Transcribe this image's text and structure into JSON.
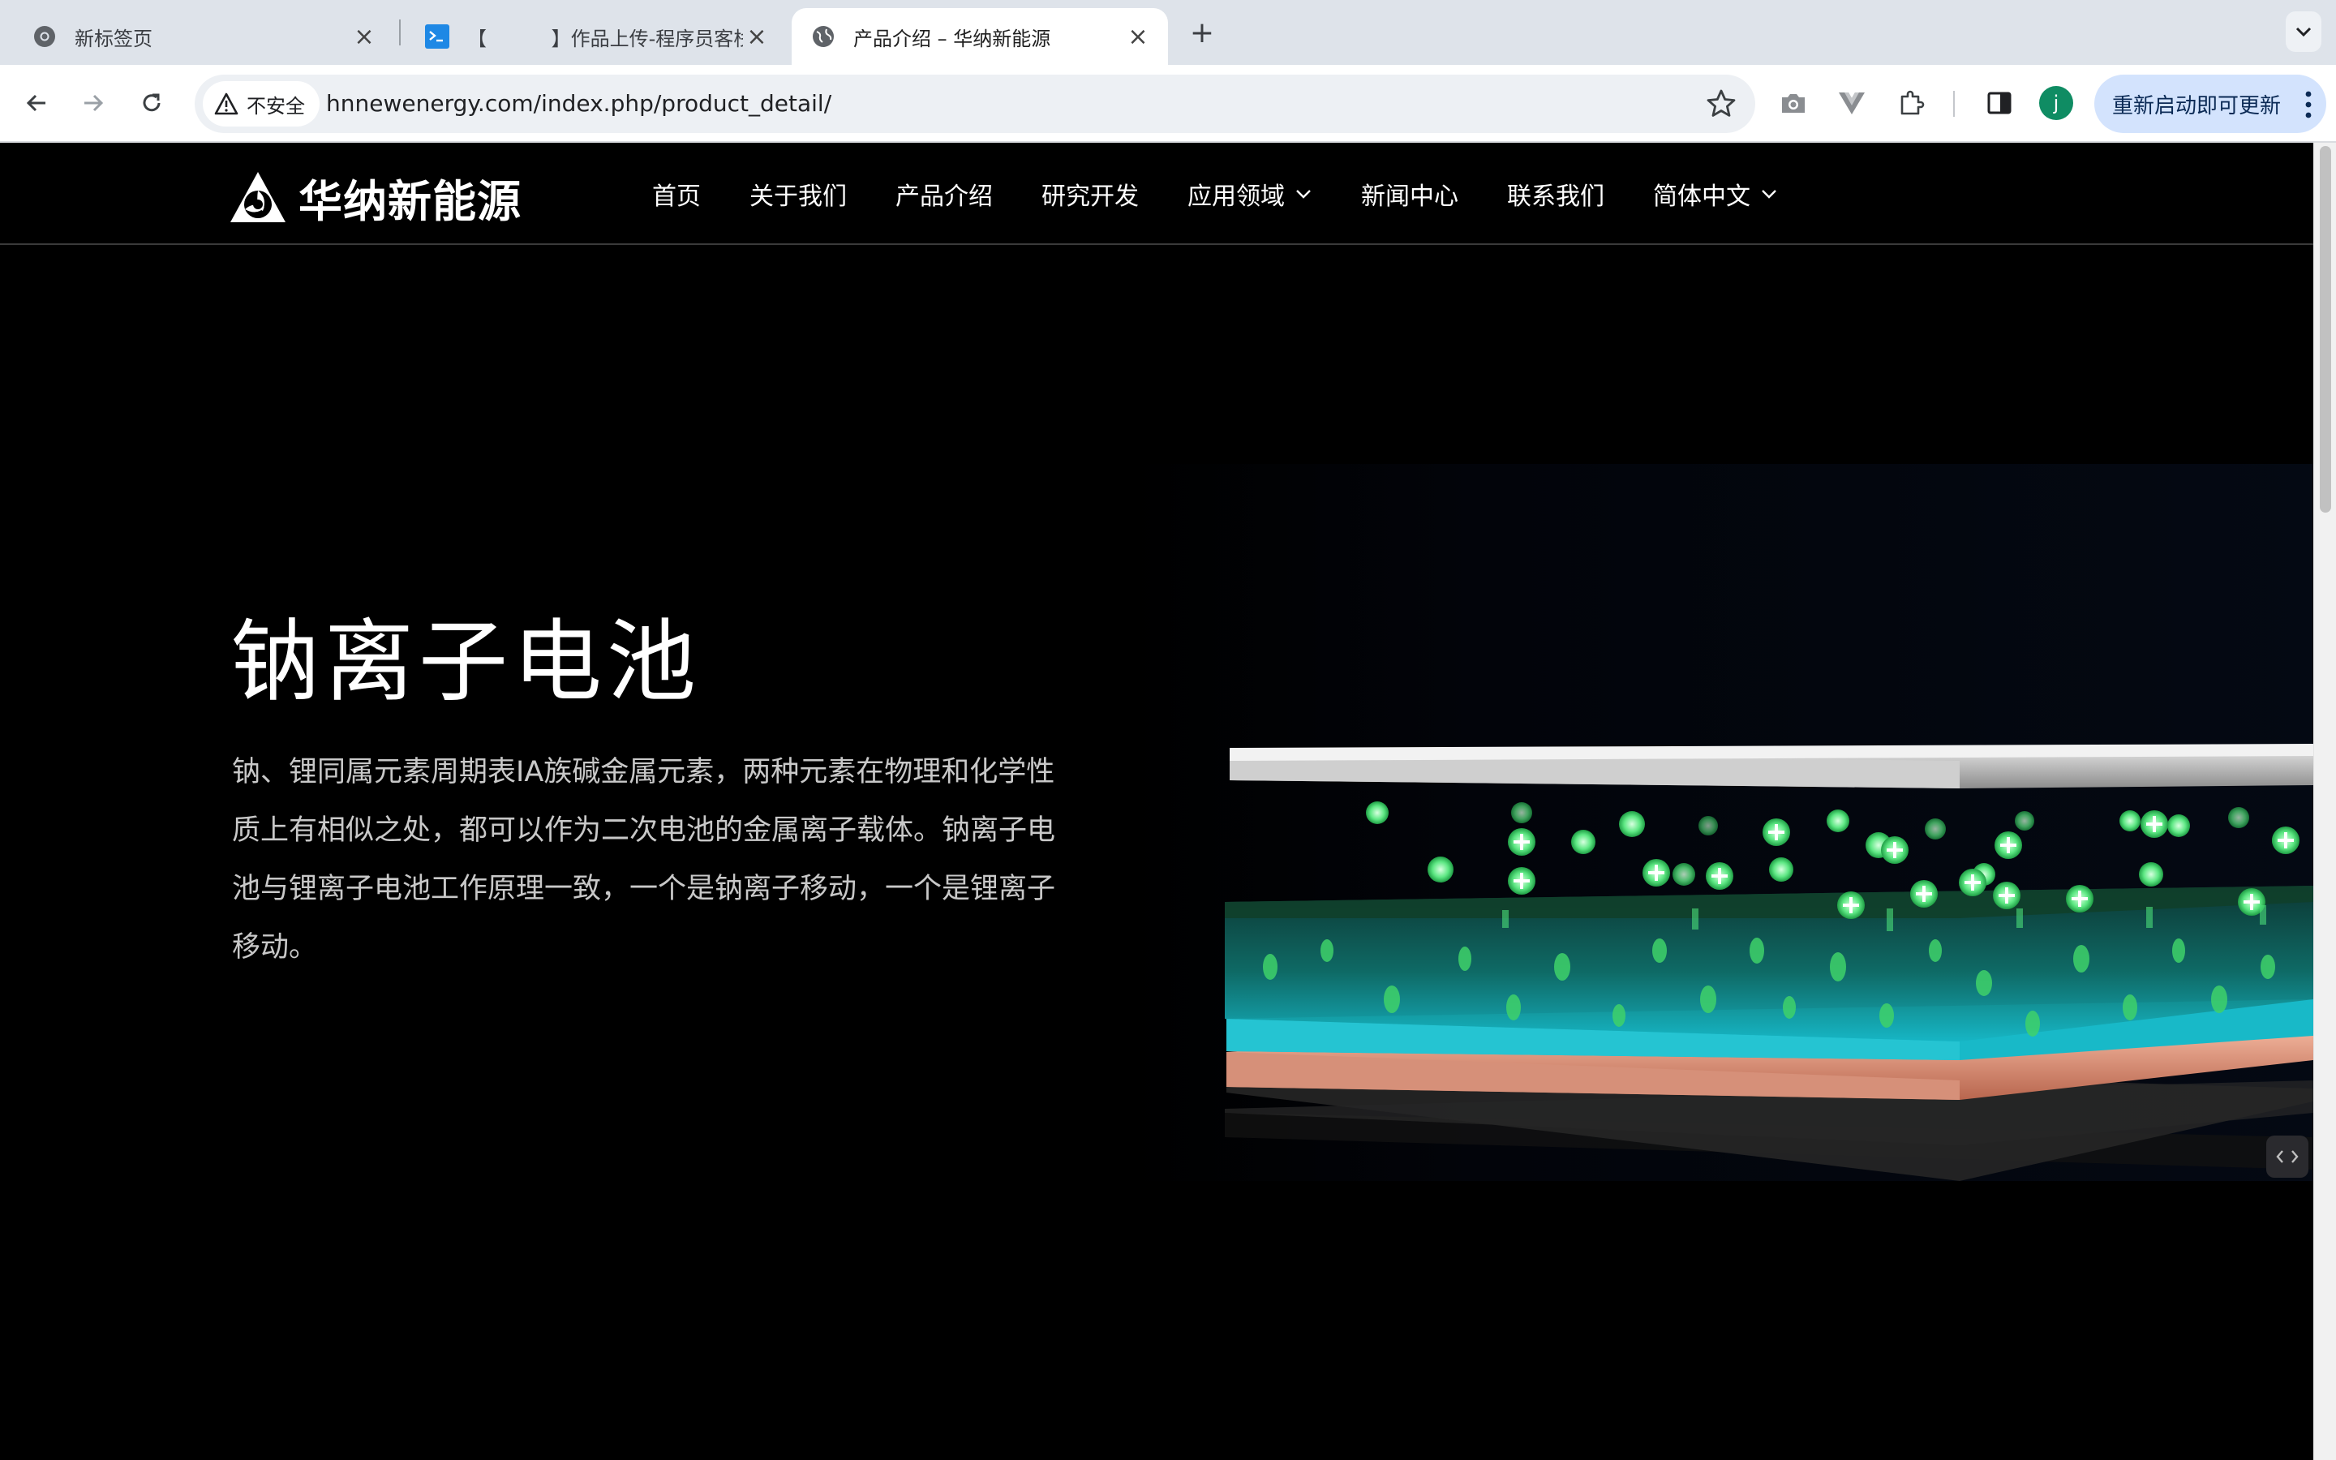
{
  "browser": {
    "tabs": [
      {
        "title": "新标签页",
        "favicon": "chrome-icon",
        "active": false
      },
      {
        "title": "【 　　　】作品上传-程序员客栈",
        "favicon": "terminal-icon",
        "active": false
      },
      {
        "title": "产品介绍 – 华纳新能源",
        "favicon": "globe-icon",
        "active": true
      }
    ],
    "security_label": "不安全",
    "url": "hnnewenergy.com/index.php/product_detail/",
    "profile_initial": "j",
    "update_label": "重新启动即可更新"
  },
  "site": {
    "logo_text": "华纳新能源",
    "nav": [
      {
        "label": "首页",
        "dropdown": false
      },
      {
        "label": "关于我们",
        "dropdown": false
      },
      {
        "label": "产品介绍",
        "dropdown": false
      },
      {
        "label": "研究开发",
        "dropdown": false
      },
      {
        "label": "应用领域",
        "dropdown": true
      },
      {
        "label": "新闻中心",
        "dropdown": false
      },
      {
        "label": "联系我们",
        "dropdown": false
      },
      {
        "label": "简体中文",
        "dropdown": true
      }
    ]
  },
  "hero": {
    "title": "钠离子电池",
    "description": "钠、锂同属元素周期表IA族碱金属元素，两种元素在物理和化学性质上有相似之处，都可以作为二次电池的金属离子载体。钠离子电池与锂离子电池工作原理一致，一个是钠离子移动，一个是锂离子移动。"
  },
  "colors": {
    "page_background": "#000000",
    "ion_green": "#3ddc6b",
    "electrolyte_teal": "#13a7b4",
    "copper_layer": "#d9907a",
    "top_plate": "#bdbdbd"
  }
}
